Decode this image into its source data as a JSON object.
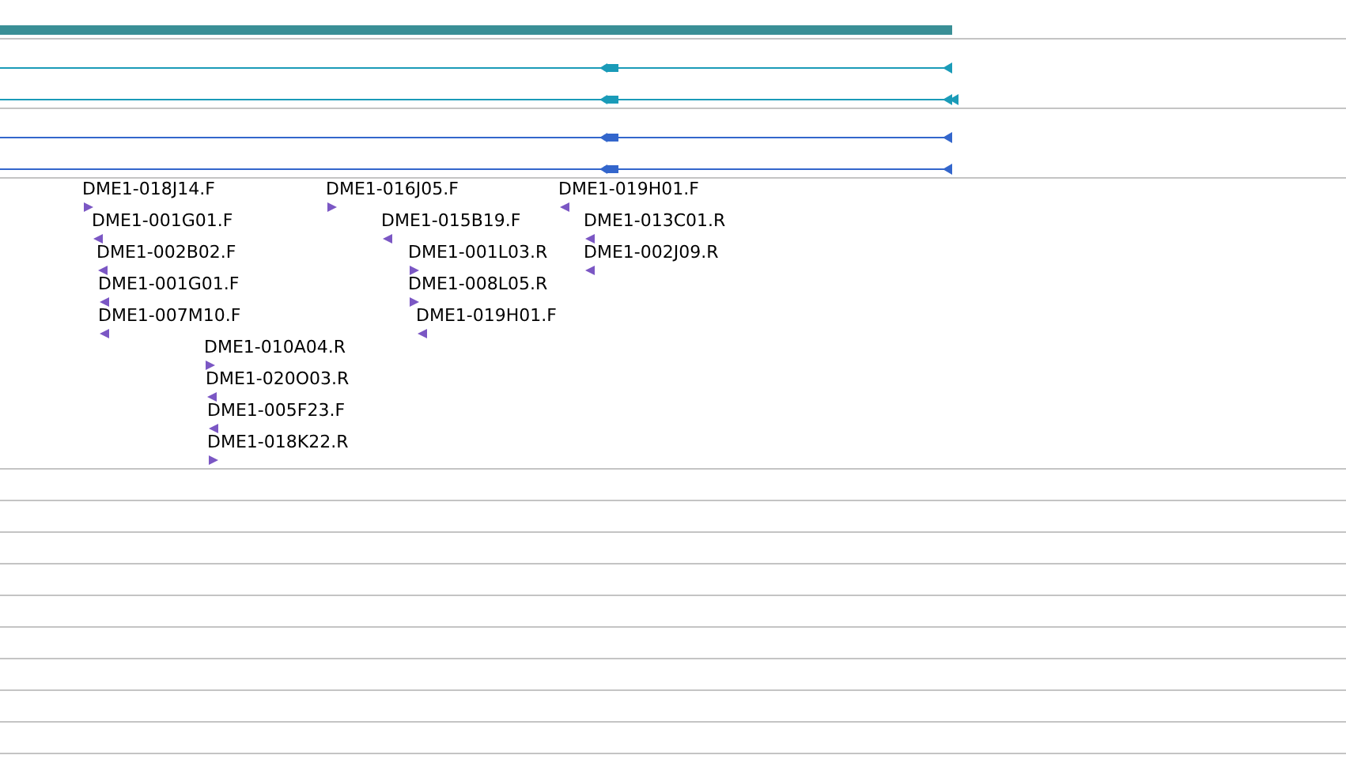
{
  "reads": [
    {
      "label": "DME1-018J14.F",
      "kind": "forward"
    },
    {
      "label": "DME1-001G01.F",
      "kind": "reverse"
    },
    {
      "label": "DME1-002B02.F",
      "kind": "reverse"
    },
    {
      "label": "DME1-001G01.F",
      "kind": "reverse"
    },
    {
      "label": "DME1-007M10.F",
      "kind": "reverse"
    },
    {
      "label": "DME1-010A04.R",
      "kind": "forward"
    },
    {
      "label": "DME1-020O03.R",
      "kind": "reverse"
    },
    {
      "label": "DME1-005F23.F",
      "kind": "reverse"
    },
    {
      "label": "DME1-018K22.R",
      "kind": "forward"
    },
    {
      "label": "DME1-016J05.F",
      "kind": "forward"
    },
    {
      "label": "DME1-015B19.F",
      "kind": "reverse"
    },
    {
      "label": "DME1-001L03.R",
      "kind": "forward"
    },
    {
      "label": "DME1-008L05.R",
      "kind": "forward"
    },
    {
      "label": "DME1-019H01.F",
      "kind": "reverse"
    },
    {
      "label": "DME1-019H01.F",
      "kind": "reverse"
    },
    {
      "label": "DME1-013C01.R",
      "kind": "reverse"
    },
    {
      "label": "DME1-002J09.R",
      "kind": "reverse"
    }
  ]
}
